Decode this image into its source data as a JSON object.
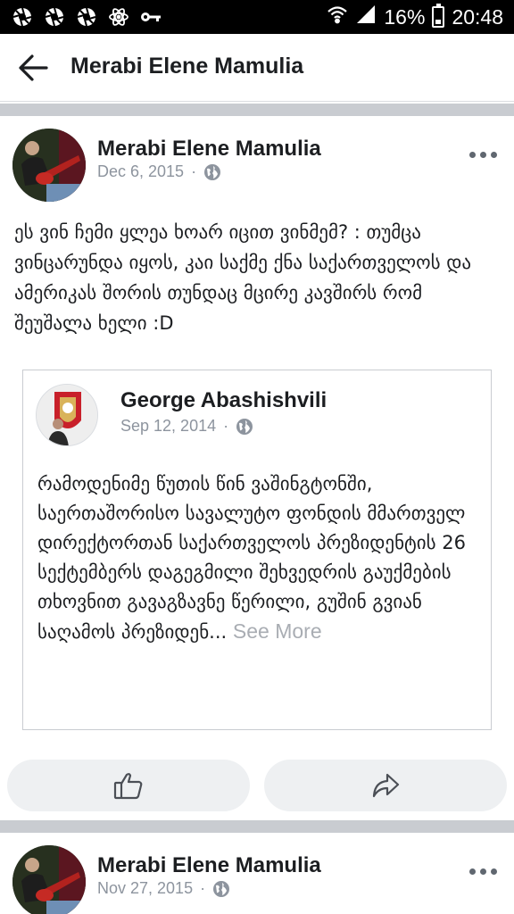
{
  "status_bar": {
    "icons": [
      "aperture-icon",
      "aperture-icon",
      "aperture-icon",
      "atom-icon",
      "key-icon"
    ],
    "battery": "16%",
    "time": "20:48"
  },
  "header": {
    "title": "Merabi Elene Mamulia",
    "back_icon": "arrow-left-icon"
  },
  "post": {
    "author": "Merabi Elene Mamulia",
    "date": "Dec 6, 2015",
    "separator": "·",
    "privacy_icon": "globe-icon",
    "text": "ეს ვინ ჩემი ყლეა ხოარ იცით ვინმემ? : თუმცა ვინცარუნდა იყოს, კაი საქმე ქნა საქართველოს და ამერიკას შორის თუნდაც მცირე კავშირს რომ შეუშალა ხელი :D",
    "shared": {
      "author": "George Abashishvili",
      "date": "Sep 12, 2014",
      "separator": "·",
      "text": "რამოდენიმე წუთის წინ ვაშინგტონში, საერთაშორისო სავალუტო ფონდის მმართველ დირექტორთან საქართველოს პრეზიდენტის 26 სექტემბერს დაგეგმილი შეხვედრის გაუქმების თხოვნით გავაგზავნე წერილი, გუშინ გვიან საღამოს პრეზიდენ...",
      "see_more": "See More"
    },
    "actions": {
      "like_icon": "thumbs-up-icon",
      "share_icon": "share-arrow-icon"
    }
  },
  "next_post": {
    "author": "Merabi Elene Mamulia",
    "date": "Nov 27, 2015",
    "separator": "·"
  },
  "colors": {
    "text": "#1c1e21",
    "meta": "#8d949e",
    "divider": "#c9ccd1",
    "button_bg": "#eef0f2",
    "see_more": "#a9adb3"
  }
}
